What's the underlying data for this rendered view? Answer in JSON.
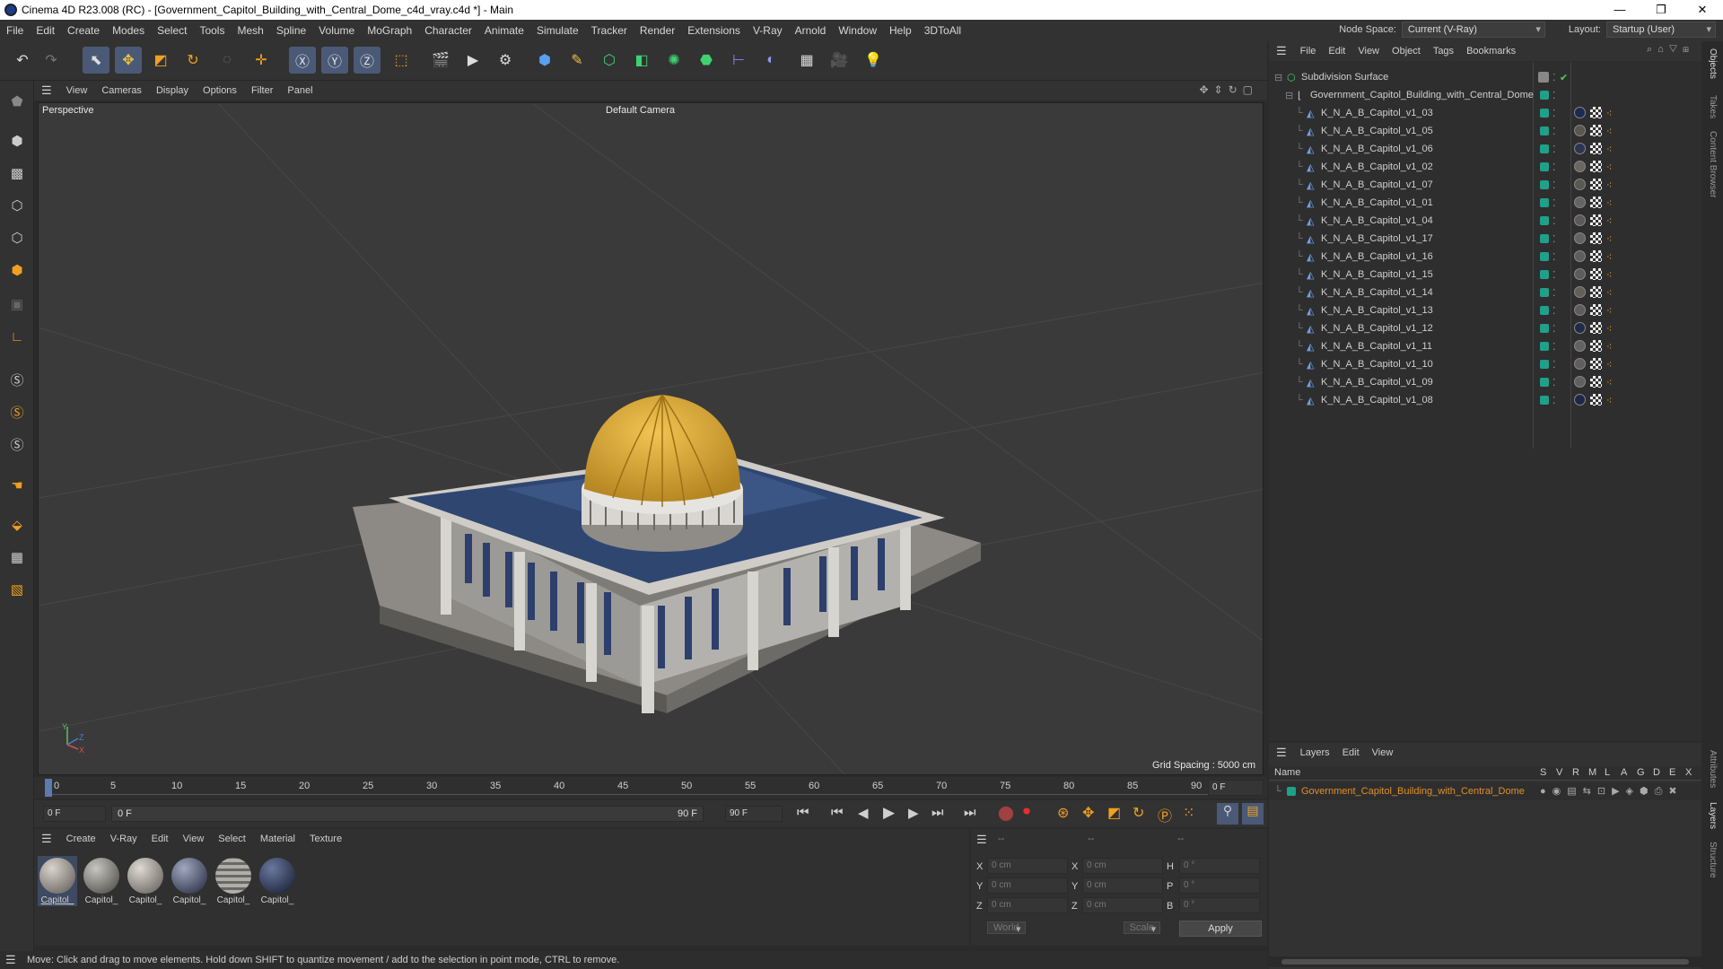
{
  "window": {
    "title": "Cinema 4D R23.008 (RC) - [Government_Capitol_Building_with_Central_Dome_c4d_vray.c4d *] - Main"
  },
  "menu": [
    "File",
    "Edit",
    "Create",
    "Modes",
    "Select",
    "Tools",
    "Mesh",
    "Spline",
    "Volume",
    "MoGraph",
    "Character",
    "Animate",
    "Simulate",
    "Tracker",
    "Render",
    "Extensions",
    "V-Ray",
    "Arnold",
    "Window",
    "Help",
    "3DToAll"
  ],
  "header_right": {
    "node_space_label": "Node Space:",
    "node_space_value": "Current (V-Ray)",
    "layout_label": "Layout:",
    "layout_value": "Startup (User)"
  },
  "viewport": {
    "menu": [
      "View",
      "Cameras",
      "Display",
      "Options",
      "Filter",
      "Panel"
    ],
    "view_name": "Perspective",
    "camera": "Default Camera",
    "grid_spacing": "Grid Spacing : 5000 cm",
    "axis_labels": {
      "y": "Y",
      "z": "Z",
      "x": "X"
    }
  },
  "timeline": {
    "ticks": [
      "0",
      "5",
      "10",
      "15",
      "20",
      "25",
      "30",
      "35",
      "40",
      "45",
      "50",
      "55",
      "60",
      "65",
      "70",
      "75",
      "80",
      "85",
      "90"
    ],
    "current_frame": "0 F",
    "start_field": "0 F",
    "range_start": "0 F",
    "range_end": "90 F",
    "end_field": "90 F"
  },
  "materials": {
    "menu": [
      "Create",
      "V-Ray",
      "Edit",
      "View",
      "Select",
      "Material",
      "Texture"
    ],
    "items": [
      "Capitol_",
      "Capitol_",
      "Capitol_",
      "Capitol_",
      "Capitol_",
      "Capitol_"
    ]
  },
  "coords": {
    "headers": [
      "--",
      "--",
      "--"
    ],
    "rows": [
      {
        "l1": "X",
        "v1": "0 cm",
        "l2": "X",
        "v2": "0 cm",
        "l3": "H",
        "v3": "0 °"
      },
      {
        "l1": "Y",
        "v1": "0 cm",
        "l2": "Y",
        "v2": "0 cm",
        "l3": "P",
        "v3": "0 °"
      },
      {
        "l1": "Z",
        "v1": "0 cm",
        "l2": "Z",
        "v2": "0 cm",
        "l3": "B",
        "v3": "0 °"
      }
    ],
    "mode": "World",
    "mode2": "Scale",
    "apply": "Apply"
  },
  "status": "Move: Click and drag to move elements. Hold down SHIFT to quantize movement / add to the selection in point mode, CTRL to remove.",
  "object_manager": {
    "menu": [
      "File",
      "Edit",
      "View",
      "Object",
      "Tags",
      "Bookmarks"
    ],
    "root": "Subdivision Surface",
    "group": "Government_Capitol_Building_with_Central_Dome",
    "objects": [
      "K_N_A_B_Capitol_v1_03",
      "K_N_A_B_Capitol_v1_05",
      "K_N_A_B_Capitol_v1_06",
      "K_N_A_B_Capitol_v1_02",
      "K_N_A_B_Capitol_v1_07",
      "K_N_A_B_Capitol_v1_01",
      "K_N_A_B_Capitol_v1_04",
      "K_N_A_B_Capitol_v1_17",
      "K_N_A_B_Capitol_v1_16",
      "K_N_A_B_Capitol_v1_15",
      "K_N_A_B_Capitol_v1_14",
      "K_N_A_B_Capitol_v1_13",
      "K_N_A_B_Capitol_v1_12",
      "K_N_A_B_Capitol_v1_11",
      "K_N_A_B_Capitol_v1_10",
      "K_N_A_B_Capitol_v1_09",
      "K_N_A_B_Capitol_v1_08"
    ]
  },
  "layer_manager": {
    "menu": [
      "Layers",
      "Edit",
      "View"
    ],
    "name_header": "Name",
    "columns": [
      "S",
      "V",
      "R",
      "M",
      "L",
      "A",
      "G",
      "D",
      "E",
      "X"
    ],
    "layer": "Government_Capitol_Building_with_Central_Dome"
  },
  "right_tabs": [
    "Objects",
    "Takes",
    "Content Browser",
    "Attributes",
    "Layers",
    "Structure"
  ],
  "colors": {
    "accent": "#4a5a76",
    "layer_orange": "#e0902a",
    "tag_green": "#1fa08a",
    "dome": "#d9a534"
  }
}
